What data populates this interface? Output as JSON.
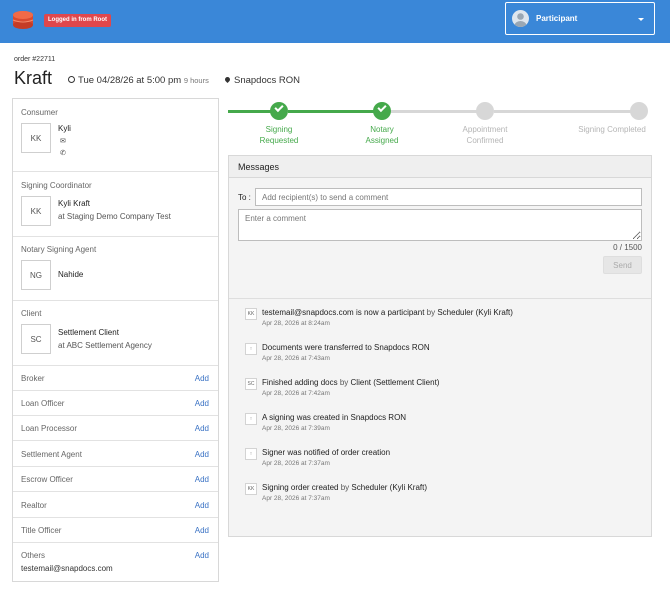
{
  "header": {
    "badge": "Logged in from Root",
    "participant_label": "Participant"
  },
  "order": {
    "number": "order #22711",
    "title": "Kraft",
    "date": "Tue 04/28/26 at 5:00 pm",
    "duration": "9 hours",
    "location": "Snapdocs RON"
  },
  "left": {
    "consumer": {
      "title": "Consumer",
      "initials": "KK",
      "name": "Kyli",
      "icon1": "✉",
      "icon2": "✆"
    },
    "coordinator": {
      "title": "Signing Coordinator",
      "initials": "KK",
      "name": "Kyli Kraft",
      "sub": "at Staging Demo Company Test"
    },
    "notary": {
      "title": "Notary Signing Agent",
      "initials": "NG",
      "name": "Nahide"
    },
    "client": {
      "title": "Client",
      "initials": "SC",
      "name": "Settlement Client",
      "sub": "at ABC Settlement Agency"
    },
    "roles": [
      {
        "label": "Broker",
        "action": "Add"
      },
      {
        "label": "Loan Officer",
        "action": "Add"
      },
      {
        "label": "Loan Processor",
        "action": "Add"
      },
      {
        "label": "Settlement Agent",
        "action": "Add"
      },
      {
        "label": "Escrow Officer",
        "action": "Add"
      },
      {
        "label": "Realtor",
        "action": "Add"
      },
      {
        "label": "Title Officer",
        "action": "Add"
      }
    ],
    "others": {
      "label": "Others",
      "action": "Add",
      "email": "testemail@snapdocs.com"
    }
  },
  "progress": {
    "steps": [
      {
        "line1": "Signing",
        "line2": "Requested",
        "status": "done"
      },
      {
        "line1": "Notary",
        "line2": "Assigned",
        "status": "done"
      },
      {
        "line1": "Appointment",
        "line2": "Confirmed",
        "status": "todo"
      },
      {
        "line1": "Signing Completed",
        "line2": "",
        "status": "todo"
      }
    ],
    "colors": {
      "done": "#45a94b",
      "todo": "#d7d7d7"
    }
  },
  "messages": {
    "title": "Messages",
    "to_label": "To :",
    "to_placeholder": "Add recipient(s) to send a comment",
    "comment_placeholder": "Enter a comment",
    "counter": "0 / 1500",
    "send_label": "Send",
    "feed": [
      {
        "avatar": "KK",
        "text": "testemail@snapdocs.com is now a participant",
        "by": "by",
        "actor": "Scheduler (Kyli Kraft)",
        "time": "Apr 28, 2026 at 8:24am"
      },
      {
        "avatar": "↑",
        "text": "Documents were transferred to Snapdocs RON",
        "by": "",
        "actor": "",
        "time": "Apr 28, 2026 at 7:43am"
      },
      {
        "avatar": "SC",
        "text": "Finished adding docs",
        "by": "by",
        "actor": "Client (Settlement Client)",
        "time": "Apr 28, 2026 at 7:42am"
      },
      {
        "avatar": "↑",
        "text": "A signing was created in Snapdocs RON",
        "by": "",
        "actor": "",
        "time": "Apr 28, 2026 at 7:39am"
      },
      {
        "avatar": "↑",
        "text": "Signer was notified of order creation",
        "by": "",
        "actor": "",
        "time": "Apr 28, 2026 at 7:37am"
      },
      {
        "avatar": "KK",
        "text": "Signing order created",
        "by": "by",
        "actor": "Scheduler (Kyli Kraft)",
        "time": "Apr 28, 2026 at 7:37am"
      }
    ]
  },
  "theme": {
    "topbar": "#3a87d8",
    "badge": "#e0474c",
    "link": "#3a72c4"
  }
}
